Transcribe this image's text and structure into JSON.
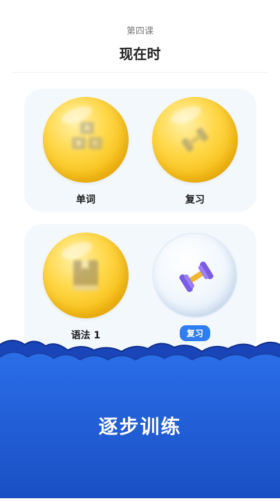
{
  "header": {
    "lesson_number": "第四课",
    "lesson_title": "现在时"
  },
  "nodes": [
    {
      "label": "单词",
      "icon": "abc-blocks-icon",
      "style": "gold"
    },
    {
      "label": "复习",
      "icon": "dumbbell-icon",
      "style": "gold"
    },
    {
      "label": "语法 1",
      "icon": "book-icon",
      "style": "gold"
    },
    {
      "label": "复习",
      "icon": "dumbbell-icon",
      "style": "glass",
      "active": true
    }
  ],
  "blocks": {
    "a": "A",
    "b": "B",
    "c": "C"
  },
  "footer": {
    "slogan": "逐步训练"
  },
  "colors": {
    "accent": "#2f7df2",
    "gold": "#f7c21a",
    "wave_dark": "#1a4fc4",
    "wave_light": "#2a6ee8",
    "dumbbell": "#7b5ce6",
    "dumbbell_handle": "#f2b632"
  }
}
